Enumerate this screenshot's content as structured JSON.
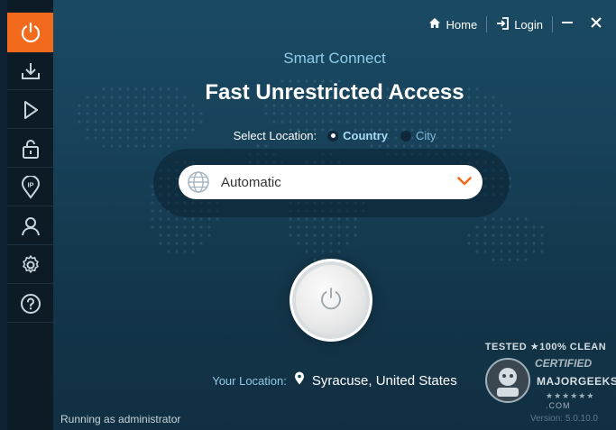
{
  "topbar": {
    "home_label": "Home",
    "login_label": "Login"
  },
  "sidebar": {
    "items": [
      {
        "icon": "power-icon"
      },
      {
        "icon": "download-icon"
      },
      {
        "icon": "play-icon"
      },
      {
        "icon": "lock-icon"
      },
      {
        "icon": "ip-location-icon"
      },
      {
        "icon": "user-icon"
      },
      {
        "icon": "gear-icon"
      },
      {
        "icon": "help-icon"
      }
    ]
  },
  "main": {
    "subtitle": "Smart Connect",
    "title": "Fast Unrestricted Access",
    "select_location_label": "Select Location:",
    "options": {
      "country": "Country",
      "city": "City",
      "selected": "Country"
    },
    "location_dropdown_value": "Automatic",
    "your_location_label": "Your Location:",
    "your_location_value": "Syracuse, United States"
  },
  "status_text": "Running as administrator",
  "version_text": "Version: 5.0.10.0",
  "watermark": {
    "line1": "TESTED ★100% CLEAN",
    "line2": "CERTIFIED",
    "line3": "MAJORGEEKS",
    "line4": "★★★★★★ .COM"
  },
  "colors": {
    "accent": "#f26b1d",
    "sidebar_bg": "#0d1b27",
    "main_bg": "#174159",
    "subtitle": "#8fcbe8",
    "radio_selected": "#a9dcf5"
  }
}
